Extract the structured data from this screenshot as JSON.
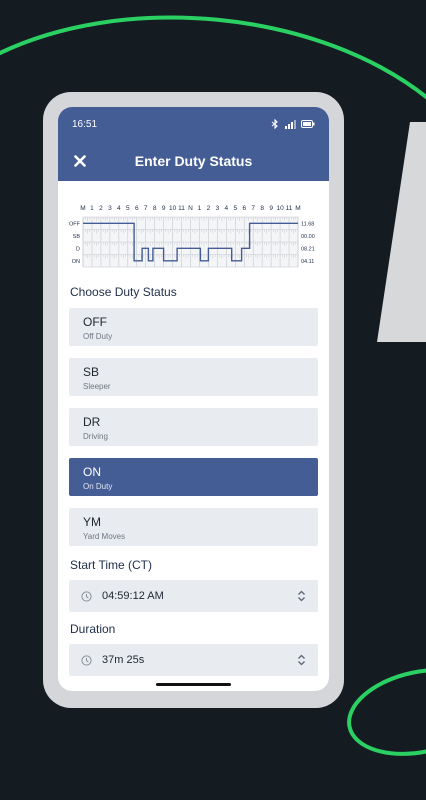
{
  "status_bar": {
    "time": "16:51"
  },
  "app_bar": {
    "title": "Enter Duty Status"
  },
  "graph": {
    "hours_top": [
      "M",
      "1",
      "2",
      "3",
      "4",
      "5",
      "6",
      "7",
      "8",
      "9",
      "10",
      "11",
      "N",
      "1",
      "2",
      "3",
      "4",
      "5",
      "6",
      "7",
      "8",
      "9",
      "10",
      "11",
      "M"
    ],
    "row_labels": [
      "OFF",
      "SB",
      "D",
      "ON"
    ],
    "row_totals": [
      "11.68",
      "00.00",
      "08.21",
      "04.11"
    ],
    "line_color": "#445d95"
  },
  "choose_label": "Choose Duty Status",
  "statuses": [
    {
      "code": "OFF",
      "desc": "Off Duty"
    },
    {
      "code": "SB",
      "desc": "Sleeper"
    },
    {
      "code": "DR",
      "desc": "Driving"
    },
    {
      "code": "ON",
      "desc": "On Duty"
    },
    {
      "code": "YM",
      "desc": "Yard Moves"
    }
  ],
  "selected_status": "ON",
  "start_time": {
    "label": "Start Time (CT)",
    "value": "04:59:12 AM"
  },
  "duration": {
    "label": "Duration",
    "value": "37m 25s"
  },
  "colors": {
    "accent": "#445d95",
    "brand_green": "#22c55e",
    "background": "#141c22"
  }
}
